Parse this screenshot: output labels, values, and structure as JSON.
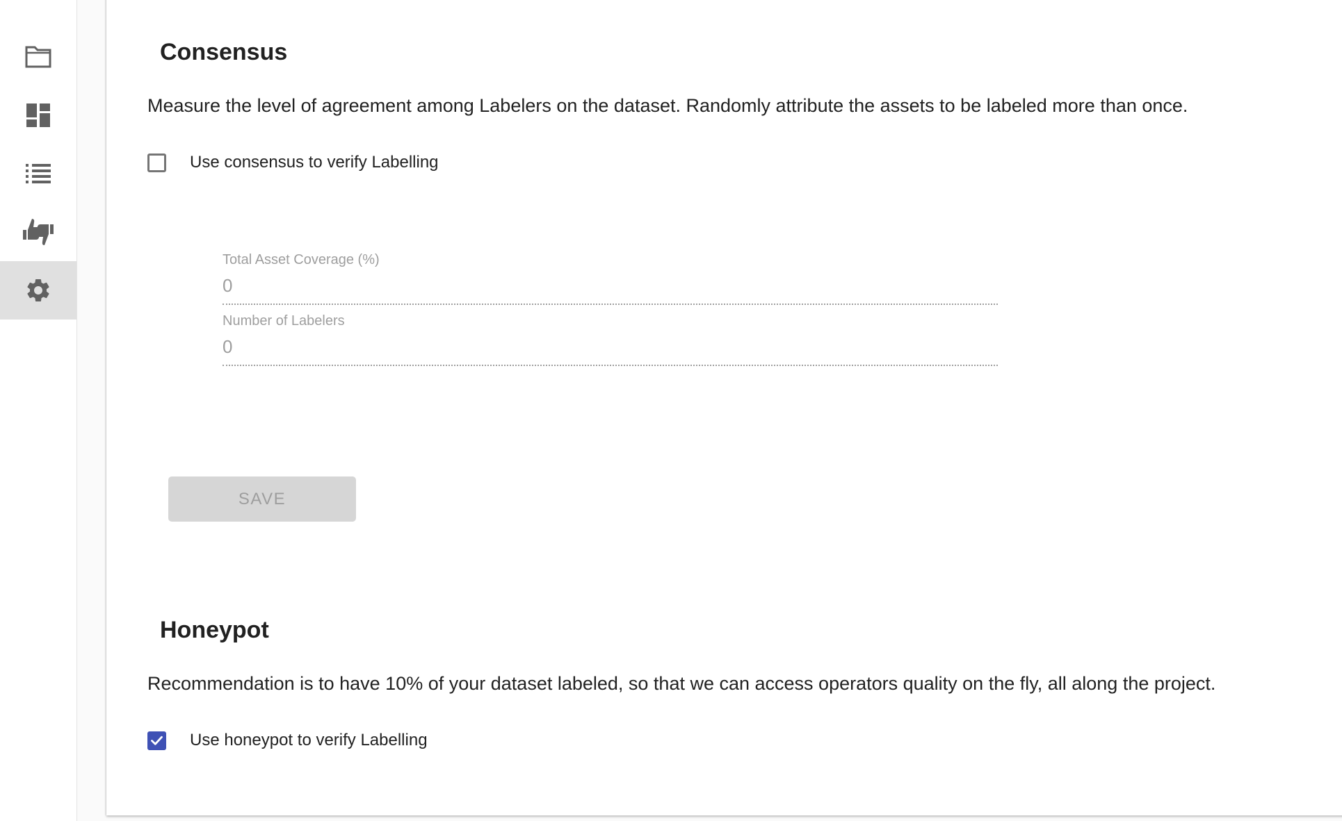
{
  "sidebar": {
    "items": [
      {
        "icon": "folder-icon"
      },
      {
        "icon": "dashboard-icon"
      },
      {
        "icon": "list-icon"
      },
      {
        "icon": "thumbs-up-down-icon"
      },
      {
        "icon": "gear-icon",
        "active": true
      }
    ]
  },
  "consensus": {
    "title": "Consensus",
    "description": "Measure the level of agreement among Labelers on the dataset. Randomly attribute the assets to be labeled more than once.",
    "checkbox_label": "Use consensus to verify Labelling",
    "checked": false,
    "coverage_label": "Total Asset Coverage (%)",
    "coverage_value": "0",
    "labelers_label": "Number of Labelers",
    "labelers_value": "0",
    "save_label": "SAVE"
  },
  "honeypot": {
    "title": "Honeypot",
    "description": "Recommendation is to have 10% of your dataset labeled, so that we can access operators quality on the fly, all along the project.",
    "checkbox_label": "Use honeypot to verify Labelling",
    "checked": true
  },
  "colors": {
    "accent": "#3f51b5",
    "icon": "#616161",
    "active_nav_bg": "#e0e0e0",
    "disabled_button_bg": "#d6d6d6"
  }
}
